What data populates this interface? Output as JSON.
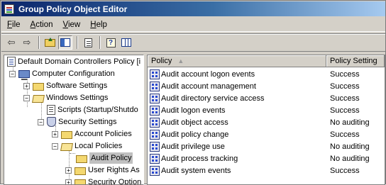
{
  "window": {
    "title": "Group Policy Object Editor"
  },
  "menu": [
    {
      "key": "F",
      "rest": "ile"
    },
    {
      "key": "A",
      "rest": "ction"
    },
    {
      "key": "V",
      "rest": "iew"
    },
    {
      "key": "H",
      "rest": "elp"
    }
  ],
  "toolbar": {
    "back": "⇦",
    "forward": "⇨"
  },
  "tree": {
    "root": "Default Domain Controllers Policy [i",
    "computer_config": "Computer Configuration",
    "software_settings": "Software Settings",
    "windows_settings": "Windows Settings",
    "scripts": "Scripts (Startup/Shutdo",
    "security_settings": "Security Settings",
    "account_policies": "Account Policies",
    "local_policies": "Local Policies",
    "audit_policy": "Audit Policy",
    "user_rights": "User Rights As",
    "security_options": "Security Option"
  },
  "list": {
    "columns": [
      "Policy",
      "Policy Setting"
    ],
    "rows": [
      {
        "policy": "Audit account logon events",
        "setting": "Success"
      },
      {
        "policy": "Audit account management",
        "setting": "Success"
      },
      {
        "policy": "Audit directory service access",
        "setting": "Success"
      },
      {
        "policy": "Audit logon events",
        "setting": "Success"
      },
      {
        "policy": "Audit object access",
        "setting": "No auditing"
      },
      {
        "policy": "Audit policy change",
        "setting": "Success"
      },
      {
        "policy": "Audit privilege use",
        "setting": "No auditing"
      },
      {
        "policy": "Audit process tracking",
        "setting": "No auditing"
      },
      {
        "policy": "Audit system events",
        "setting": "Success"
      }
    ]
  }
}
